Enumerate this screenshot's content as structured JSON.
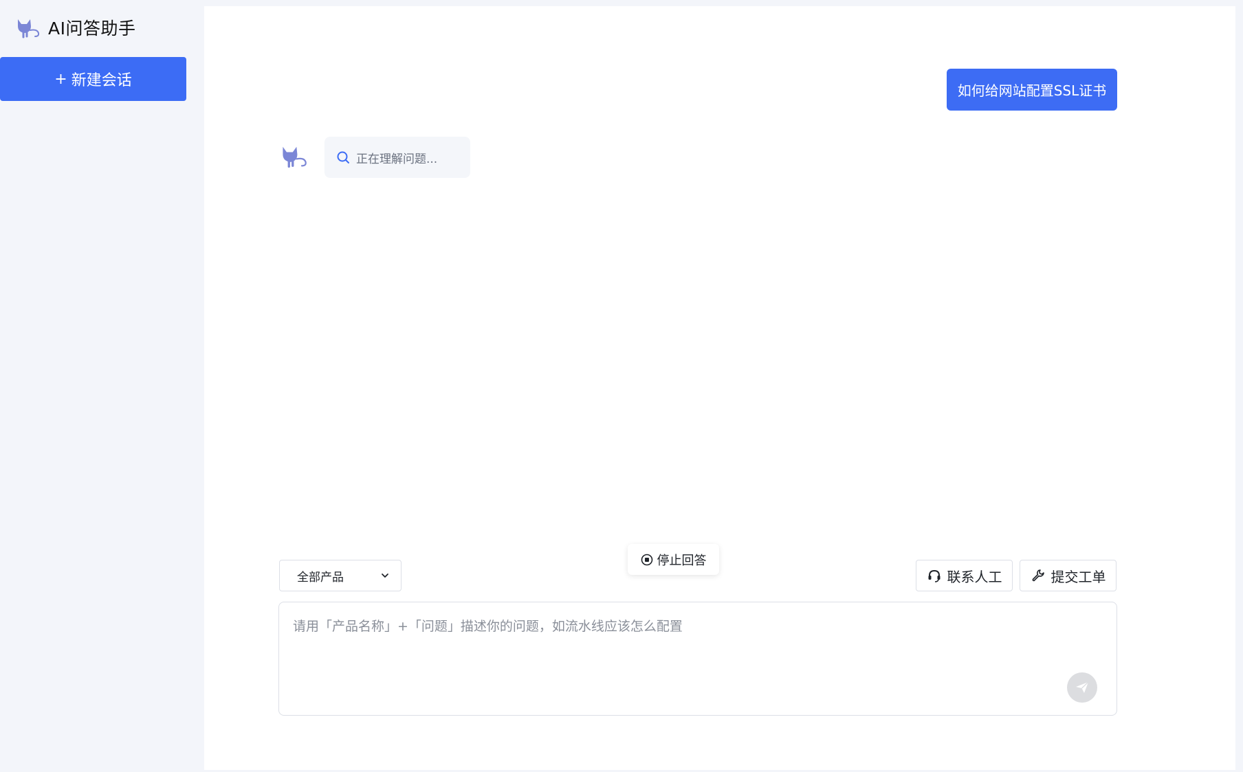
{
  "app": {
    "title": "AI问答助手",
    "new_chat_label": "新建会话",
    "new_chat_plus": "+"
  },
  "conversation": {
    "user_message": "如何给网站配置SSL证书",
    "bot_status": "正在理解问题..."
  },
  "controls": {
    "stop_label": "停止回答",
    "product_selected": "全部产品",
    "contact_label": "联系人工",
    "ticket_label": "提交工单"
  },
  "input": {
    "placeholder": "请用「产品名称」+「问题」描述你的问题，如流水线应该怎么配置",
    "value": ""
  },
  "colors": {
    "accent": "#3c6cf5",
    "sidebar_bg": "#f3f5fa",
    "logo": "#7b86d6"
  },
  "icons": {
    "brand": "cat-logo-icon",
    "bot": "cat-avatar-icon",
    "thinking": "search-icon",
    "stop": "stop-circle-icon",
    "dropdown": "chevron-down-icon",
    "contact": "headset-icon",
    "ticket": "wrench-icon",
    "send": "send-icon"
  }
}
